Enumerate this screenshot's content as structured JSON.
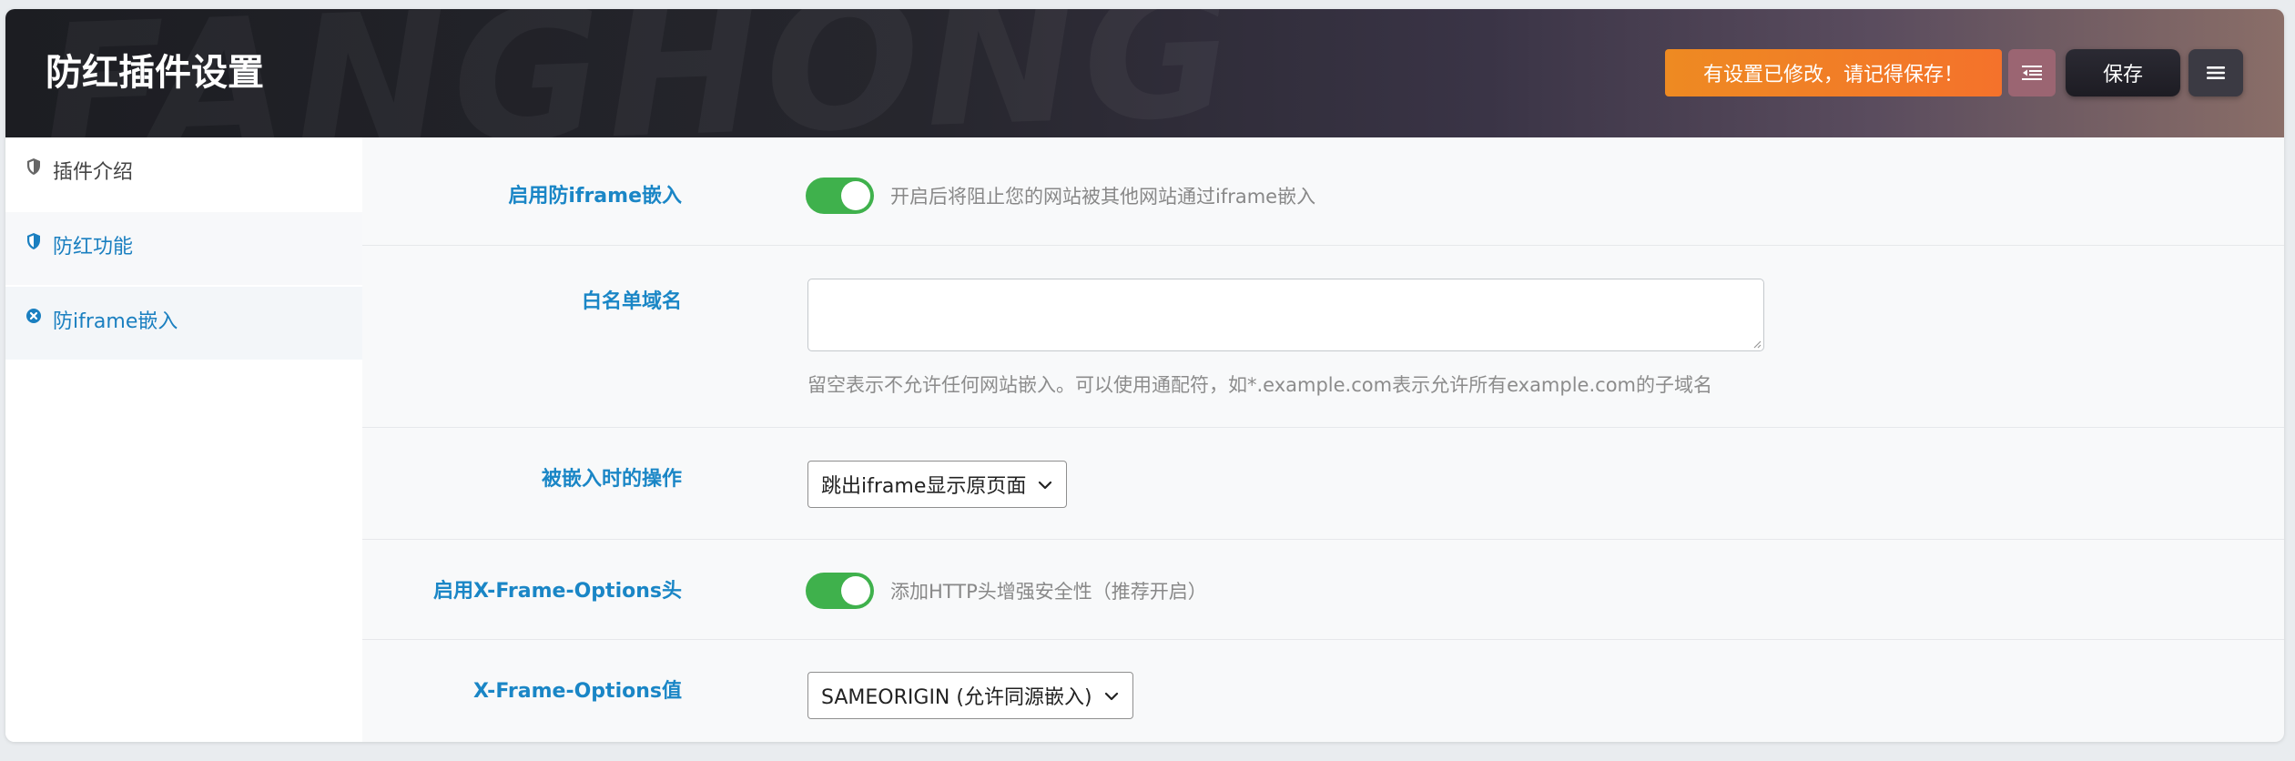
{
  "header": {
    "title": "防红插件设置",
    "watermark": "FANGHONG",
    "unsaved_notice": "有设置已修改，请记得保存！",
    "save_label": "保存"
  },
  "sidebar": {
    "items": [
      {
        "label": "插件介绍",
        "icon": "shield-icon"
      },
      {
        "label": "防红功能",
        "icon": "shield-icon"
      },
      {
        "label": "防iframe嵌入",
        "icon": "close-circle-icon"
      }
    ]
  },
  "settings": {
    "enable_anti_iframe": {
      "label": "启用防iframe嵌入",
      "enabled": true,
      "description": "开启后将阻止您的网站被其他网站通过iframe嵌入"
    },
    "whitelist": {
      "label": "白名单域名",
      "value": "",
      "help": "留空表示不允许任何网站嵌入。可以使用通配符，如*.example.com表示允许所有example.com的子域名"
    },
    "embed_action": {
      "label": "被嵌入时的操作",
      "selected": "跳出iframe显示原页面"
    },
    "enable_xfo": {
      "label": "启用X-Frame-Options头",
      "enabled": true,
      "description": "添加HTTP头增强安全性（推荐开启）"
    },
    "xfo_value": {
      "label": "X-Frame-Options值",
      "selected": "SAMEORIGIN (允许同源嵌入)"
    }
  },
  "colors": {
    "accent": "#1a86c6",
    "toggle_on": "#3fb14c",
    "notice": "#f07d28"
  }
}
